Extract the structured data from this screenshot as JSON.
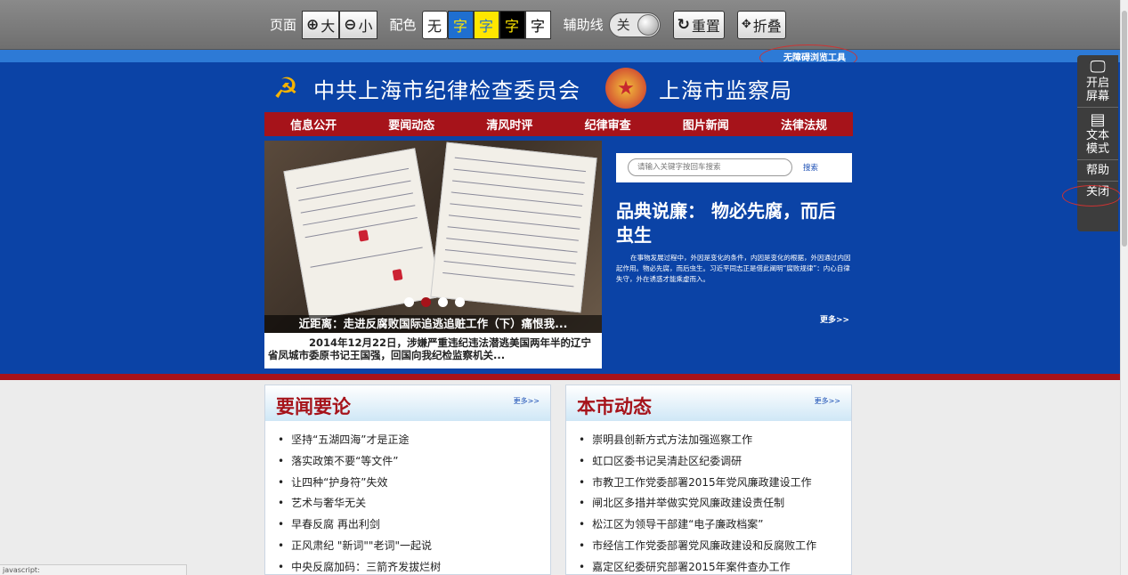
{
  "toolbar": {
    "page_label": "页面",
    "zoom_in": "大",
    "zoom_out": "小",
    "color_label": "配色",
    "color_options": [
      "无",
      "字",
      "字",
      "字",
      "字"
    ],
    "guide_label": "辅助线",
    "guide_toggle": "关",
    "reset": "重置",
    "fold": "折叠",
    "colors": {
      "blue_bg": "#1f6fd0",
      "yellow_bg": "#ffe600",
      "black_bg": "#000000",
      "white_bg": "#ffffff"
    }
  },
  "accessibility_link": "无障碍浏览工具",
  "header": {
    "org_name": "中共上海市纪律检查委员会",
    "bureau_name": "上海市监察局"
  },
  "nav": {
    "items": [
      "信息公开",
      "要闻动态",
      "清风时评",
      "纪律审查",
      "图片新闻",
      "法律法规"
    ]
  },
  "slider": {
    "caption": "近距离：走进反腐败国际追逃追赃工作（下）痛恨我...",
    "summary": "2014年12月22日，涉嫌严重违纪违法潜逃美国两年半的辽宁省凤城市委原书记王国强，回国向我纪检监察机关...",
    "dots": 4,
    "active_dot": 2
  },
  "search": {
    "placeholder": "请输入关键字按回车搜索",
    "button": "搜索"
  },
  "feature": {
    "headline": "品典说廉： 物必先腐，而后虫生",
    "body": "在事物发展过程中，外因是变化的条件，内因是变化的根据，外因通过内因起作用。物必先腐，而后虫生。习近平同志正是借此阐明“腐败规律”：内心自律失守，外在诱惑才能乘虚而入。",
    "more": "更多>>"
  },
  "panels": [
    {
      "title": "要闻要论",
      "more": "更多>>",
      "items": [
        "坚持“五湖四海”才是正途",
        "落实政策不要“等文件”",
        "让四种“护身符”失效",
        "艺术与奢华无关",
        "早春反腐 再出利剑",
        "正风肃纪 \"新词\"\"老词\"一起说",
        "中央反腐加码：三箭齐发拔烂树"
      ]
    },
    {
      "title": "本市动态",
      "more": "更多>>",
      "items": [
        "崇明县创新方式方法加强巡察工作",
        "虹口区委书记吴清赴区纪委调研",
        "市教卫工作党委部署2015年党风廉政建设工作",
        "闸北区多措并举做实党风廉政建设责任制",
        "松江区为领导干部建“电子廉政档案”",
        "市经信工作党委部署党风廉政建设和反腐败工作",
        "嘉定区纪委研究部署2015年案件查办工作"
      ]
    }
  ],
  "side_toolbar": {
    "screen_reader": "开启屏幕",
    "text_mode": "文本模式",
    "help": "帮助",
    "close": "关闭"
  },
  "status_bar": "javascript:"
}
